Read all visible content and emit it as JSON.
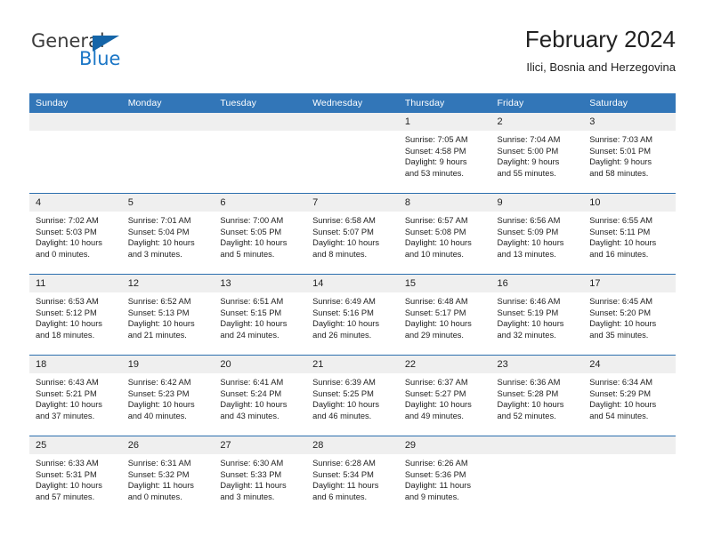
{
  "brand": {
    "name_top": "General",
    "name_bottom": "Blue",
    "triangle_color": "#1565a8",
    "blue_color": "#1b76c6"
  },
  "header": {
    "title": "February 2024",
    "subtitle": "Ilici, Bosnia and Herzegovina"
  },
  "theme": {
    "header_bg": "#3276b8",
    "row_divider": "#2c6fae",
    "daynum_bg": "#efefef"
  },
  "weekday_headers": [
    "Sunday",
    "Monday",
    "Tuesday",
    "Wednesday",
    "Thursday",
    "Friday",
    "Saturday"
  ],
  "weeks": [
    [
      {
        "day": "",
        "lines": []
      },
      {
        "day": "",
        "lines": []
      },
      {
        "day": "",
        "lines": []
      },
      {
        "day": "",
        "lines": []
      },
      {
        "day": "1",
        "lines": [
          "Sunrise: 7:05 AM",
          "Sunset: 4:58 PM",
          "Daylight: 9 hours",
          "and 53 minutes."
        ]
      },
      {
        "day": "2",
        "lines": [
          "Sunrise: 7:04 AM",
          "Sunset: 5:00 PM",
          "Daylight: 9 hours",
          "and 55 minutes."
        ]
      },
      {
        "day": "3",
        "lines": [
          "Sunrise: 7:03 AM",
          "Sunset: 5:01 PM",
          "Daylight: 9 hours",
          "and 58 minutes."
        ]
      }
    ],
    [
      {
        "day": "4",
        "lines": [
          "Sunrise: 7:02 AM",
          "Sunset: 5:03 PM",
          "Daylight: 10 hours",
          "and 0 minutes."
        ]
      },
      {
        "day": "5",
        "lines": [
          "Sunrise: 7:01 AM",
          "Sunset: 5:04 PM",
          "Daylight: 10 hours",
          "and 3 minutes."
        ]
      },
      {
        "day": "6",
        "lines": [
          "Sunrise: 7:00 AM",
          "Sunset: 5:05 PM",
          "Daylight: 10 hours",
          "and 5 minutes."
        ]
      },
      {
        "day": "7",
        "lines": [
          "Sunrise: 6:58 AM",
          "Sunset: 5:07 PM",
          "Daylight: 10 hours",
          "and 8 minutes."
        ]
      },
      {
        "day": "8",
        "lines": [
          "Sunrise: 6:57 AM",
          "Sunset: 5:08 PM",
          "Daylight: 10 hours",
          "and 10 minutes."
        ]
      },
      {
        "day": "9",
        "lines": [
          "Sunrise: 6:56 AM",
          "Sunset: 5:09 PM",
          "Daylight: 10 hours",
          "and 13 minutes."
        ]
      },
      {
        "day": "10",
        "lines": [
          "Sunrise: 6:55 AM",
          "Sunset: 5:11 PM",
          "Daylight: 10 hours",
          "and 16 minutes."
        ]
      }
    ],
    [
      {
        "day": "11",
        "lines": [
          "Sunrise: 6:53 AM",
          "Sunset: 5:12 PM",
          "Daylight: 10 hours",
          "and 18 minutes."
        ]
      },
      {
        "day": "12",
        "lines": [
          "Sunrise: 6:52 AM",
          "Sunset: 5:13 PM",
          "Daylight: 10 hours",
          "and 21 minutes."
        ]
      },
      {
        "day": "13",
        "lines": [
          "Sunrise: 6:51 AM",
          "Sunset: 5:15 PM",
          "Daylight: 10 hours",
          "and 24 minutes."
        ]
      },
      {
        "day": "14",
        "lines": [
          "Sunrise: 6:49 AM",
          "Sunset: 5:16 PM",
          "Daylight: 10 hours",
          "and 26 minutes."
        ]
      },
      {
        "day": "15",
        "lines": [
          "Sunrise: 6:48 AM",
          "Sunset: 5:17 PM",
          "Daylight: 10 hours",
          "and 29 minutes."
        ]
      },
      {
        "day": "16",
        "lines": [
          "Sunrise: 6:46 AM",
          "Sunset: 5:19 PM",
          "Daylight: 10 hours",
          "and 32 minutes."
        ]
      },
      {
        "day": "17",
        "lines": [
          "Sunrise: 6:45 AM",
          "Sunset: 5:20 PM",
          "Daylight: 10 hours",
          "and 35 minutes."
        ]
      }
    ],
    [
      {
        "day": "18",
        "lines": [
          "Sunrise: 6:43 AM",
          "Sunset: 5:21 PM",
          "Daylight: 10 hours",
          "and 37 minutes."
        ]
      },
      {
        "day": "19",
        "lines": [
          "Sunrise: 6:42 AM",
          "Sunset: 5:23 PM",
          "Daylight: 10 hours",
          "and 40 minutes."
        ]
      },
      {
        "day": "20",
        "lines": [
          "Sunrise: 6:41 AM",
          "Sunset: 5:24 PM",
          "Daylight: 10 hours",
          "and 43 minutes."
        ]
      },
      {
        "day": "21",
        "lines": [
          "Sunrise: 6:39 AM",
          "Sunset: 5:25 PM",
          "Daylight: 10 hours",
          "and 46 minutes."
        ]
      },
      {
        "day": "22",
        "lines": [
          "Sunrise: 6:37 AM",
          "Sunset: 5:27 PM",
          "Daylight: 10 hours",
          "and 49 minutes."
        ]
      },
      {
        "day": "23",
        "lines": [
          "Sunrise: 6:36 AM",
          "Sunset: 5:28 PM",
          "Daylight: 10 hours",
          "and 52 minutes."
        ]
      },
      {
        "day": "24",
        "lines": [
          "Sunrise: 6:34 AM",
          "Sunset: 5:29 PM",
          "Daylight: 10 hours",
          "and 54 minutes."
        ]
      }
    ],
    [
      {
        "day": "25",
        "lines": [
          "Sunrise: 6:33 AM",
          "Sunset: 5:31 PM",
          "Daylight: 10 hours",
          "and 57 minutes."
        ]
      },
      {
        "day": "26",
        "lines": [
          "Sunrise: 6:31 AM",
          "Sunset: 5:32 PM",
          "Daylight: 11 hours",
          "and 0 minutes."
        ]
      },
      {
        "day": "27",
        "lines": [
          "Sunrise: 6:30 AM",
          "Sunset: 5:33 PM",
          "Daylight: 11 hours",
          "and 3 minutes."
        ]
      },
      {
        "day": "28",
        "lines": [
          "Sunrise: 6:28 AM",
          "Sunset: 5:34 PM",
          "Daylight: 11 hours",
          "and 6 minutes."
        ]
      },
      {
        "day": "29",
        "lines": [
          "Sunrise: 6:26 AM",
          "Sunset: 5:36 PM",
          "Daylight: 11 hours",
          "and 9 minutes."
        ]
      },
      {
        "day": "",
        "lines": []
      },
      {
        "day": "",
        "lines": []
      }
    ]
  ]
}
